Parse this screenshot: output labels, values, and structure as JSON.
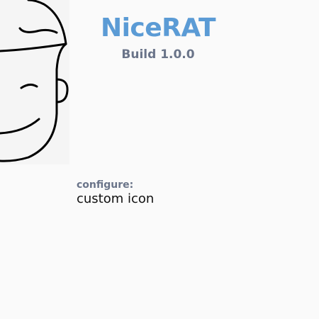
{
  "app": {
    "title": "NiceRAT",
    "build": "Build 1.0.0"
  },
  "configure": {
    "label": "configure:",
    "value": "custom icon"
  },
  "icons": {
    "face": "cartoon-face-icon"
  },
  "colors": {
    "background": "#fafafa",
    "title": "#5b9bd5",
    "subtitle": "#6a7489",
    "text": "#111111"
  }
}
